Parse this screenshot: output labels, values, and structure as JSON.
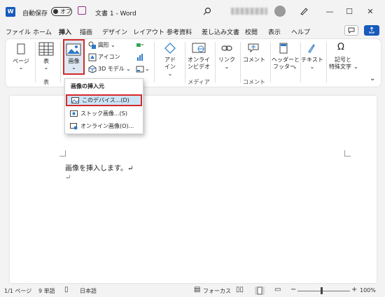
{
  "titlebar": {
    "app_icon": "word-icon",
    "autosave_label": "自動保存",
    "autosave_state": "オフ",
    "doc_title": "文書 1 - Word",
    "minimize": "—",
    "maximize": "☐",
    "close": "✕"
  },
  "menu": {
    "tabs": [
      "ファイル",
      "ホーム",
      "挿入",
      "描画",
      "デザイン",
      "レイアウト",
      "参考資料",
      "差し込み文書",
      "校閲",
      "表示",
      "ヘルプ"
    ],
    "active": "挿入"
  },
  "ribbon": {
    "page_label": "ページ",
    "table_label": "表",
    "image_label": "画像",
    "shapes_label": "図形",
    "icons_label": "アイコン",
    "model3d_label": "3D モデル",
    "addins_label1": "アド",
    "addins_label2": "イン",
    "online_video_label1": "オンライ",
    "online_video_label2": "ンビデオ",
    "link_label": "リンク",
    "comment_label": "コメント",
    "header_footer_label1": "ヘッダーと",
    "header_footer_label2": "フッター",
    "text_label": "テキスト",
    "symbols_label1": "記号と",
    "symbols_label2": "特殊文字",
    "groups": {
      "table": "表",
      "media": "メディア",
      "comment": "コメント"
    }
  },
  "dropdown": {
    "title": "画像の挿入元",
    "items": [
      "このデバイス...(D)",
      "ストック画像...(S)",
      "オンライン画像(O)..."
    ]
  },
  "document": {
    "line1": "画像を挿入します。↵",
    "line2": "↵"
  },
  "status": {
    "page": "1/1 ページ",
    "words": "9 単語",
    "language": "日本語",
    "focus": "フォーカス",
    "zoom": "100%",
    "zoom_minus": "−",
    "zoom_plus": "+"
  },
  "colors": {
    "accent": "#185abd",
    "highlight_border": "#d42a2a",
    "selection": "#cde4f7"
  }
}
